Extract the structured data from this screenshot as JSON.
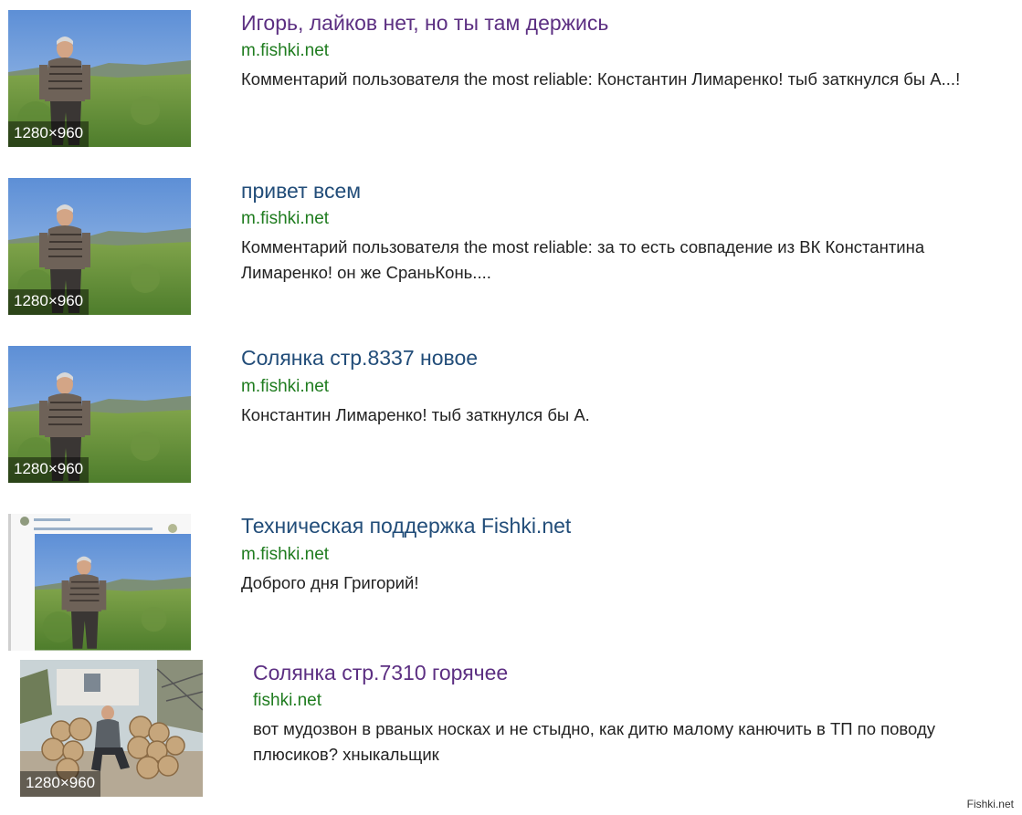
{
  "colors": {
    "title_visited": "#5c2f82",
    "title_unvisited": "#224d79",
    "domain": "#1f7c1f",
    "snippet": "#222222",
    "badge_background": "rgba(0,0,0,0.45)"
  },
  "results": [
    {
      "title": "Игорь, лайков нет, но ты там держись",
      "domain": "m.fishki.net",
      "snippet": "Комментарий пользователя the most reliable: Константин Лимаренко! тыб заткнулся бы А...!",
      "image_size": "1280×960",
      "thumbnail_icon": "man-in-field-photo"
    },
    {
      "title": "привет всем",
      "domain": "m.fishki.net",
      "snippet": "Комментарий пользователя the most reliable: за то есть совпадение из ВК Константина Лимаренко! он же СраньКонь....",
      "image_size": "1280×960",
      "thumbnail_icon": "man-in-field-photo"
    },
    {
      "title": "Солянка стр.8337 новое",
      "domain": "m.fishki.net",
      "snippet": "Константин Лимаренко! тыб заткнулся бы А.",
      "image_size": "1280×960",
      "thumbnail_icon": "man-in-field-photo"
    },
    {
      "title": "Техническая поддержка Fishki.net",
      "domain": "m.fishki.net",
      "snippet": "Доброго дня Григорий!",
      "thumbnail_icon": "comment-screenshot-photo"
    },
    {
      "title": "Солянка стр.7310 горячее",
      "domain": "fishki.net",
      "snippet": "вот мудозвон в рваных носках и не стыдно, как дитю малому канючить в ТП по поводу плюсиков? хныкальщик",
      "image_size": "1280×960",
      "thumbnail_icon": "man-on-logs-photo"
    }
  ],
  "watermark": "Fishki.net"
}
